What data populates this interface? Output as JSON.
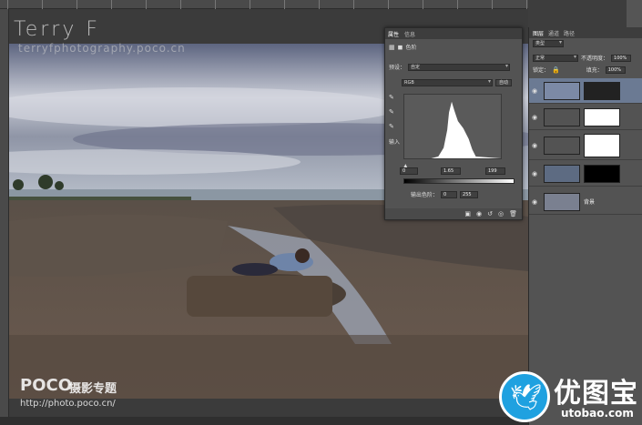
{
  "watermark": {
    "name": "Terry F",
    "url": "terryfphotography.poco.cn"
  },
  "poco": {
    "logo": "POCO",
    "subtitle": "摄影专题",
    "url": "http://photo.poco.cn/"
  },
  "properties_panel": {
    "tabs": [
      "属性",
      "信息"
    ],
    "layer_type_label": "色阶",
    "preset_label": "预设：",
    "preset_value": "自定",
    "channel_value": "RGB",
    "auto_button": "自动",
    "input_label": "输入",
    "input_black": "0",
    "input_gamma": "1.65",
    "input_white": "199",
    "output_label": "输出色阶：",
    "output_black": "0",
    "output_white": "255"
  },
  "layers_panel": {
    "tabs": [
      "图层",
      "通道",
      "路径"
    ],
    "filter_kind": "类型",
    "blend_mode": "正常",
    "opacity_label": "不透明度：",
    "opacity_value": "100%",
    "lock_label": "锁定：",
    "fill_label": "填充：",
    "fill_value": "100%",
    "layers": [
      {
        "name": "",
        "visible": true,
        "selected": true
      },
      {
        "name": "",
        "visible": true,
        "selected": false
      },
      {
        "name": "",
        "visible": true,
        "selected": false
      },
      {
        "name": "",
        "visible": true,
        "selected": false
      },
      {
        "name": "背景",
        "visible": true,
        "selected": false
      }
    ]
  },
  "branding": {
    "cn": "优图宝",
    "url": "utobao.com"
  },
  "colors": {
    "panel_bg": "#535353",
    "selected_layer": "#6b7a93",
    "logo_blue": "#1fa1e0"
  }
}
